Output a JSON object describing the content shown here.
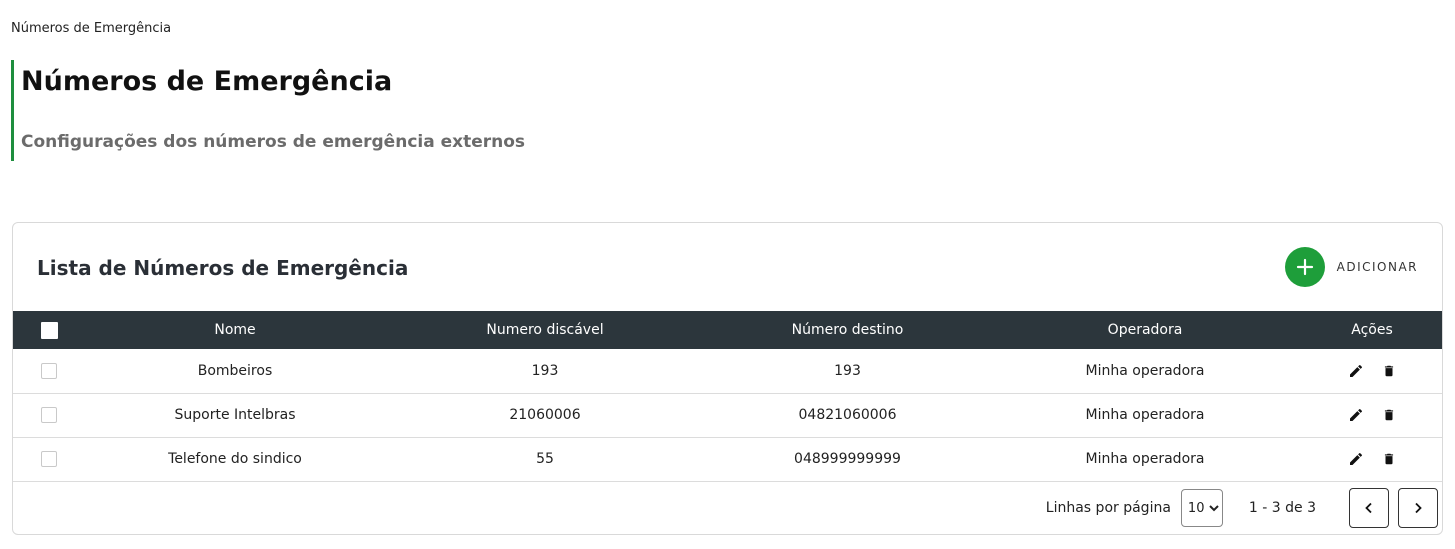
{
  "breadcrumb": "Números de Emergência",
  "page": {
    "title": "Números de Emergência",
    "subtitle": "Configurações dos números de emergência externos"
  },
  "card": {
    "title": "Lista de Números de Emergência",
    "add_label": "ADICIONAR",
    "add_icon": "plus-icon"
  },
  "table": {
    "headers": {
      "nome": "Nome",
      "numero_discavel": "Numero discável",
      "numero_destino": "Número destino",
      "operadora": "Operadora",
      "acoes": "Ações"
    },
    "rows": [
      {
        "nome": "Bombeiros",
        "numero_discavel": "193",
        "numero_destino": "193",
        "operadora": "Minha operadora"
      },
      {
        "nome": "Suporte Intelbras",
        "numero_discavel": "21060006",
        "numero_destino": "04821060006",
        "operadora": "Minha operadora"
      },
      {
        "nome": "Telefone do sindico",
        "numero_discavel": "55",
        "numero_destino": "048999999999",
        "operadora": "Minha operadora"
      }
    ]
  },
  "pagination": {
    "rows_label": "Linhas por página",
    "rows_per_page": "10",
    "range": "1 - 3 de 3"
  },
  "colors": {
    "accent": "#1e8e3e",
    "add_button": "#1e9e3a",
    "table_header": "#2c363c"
  }
}
